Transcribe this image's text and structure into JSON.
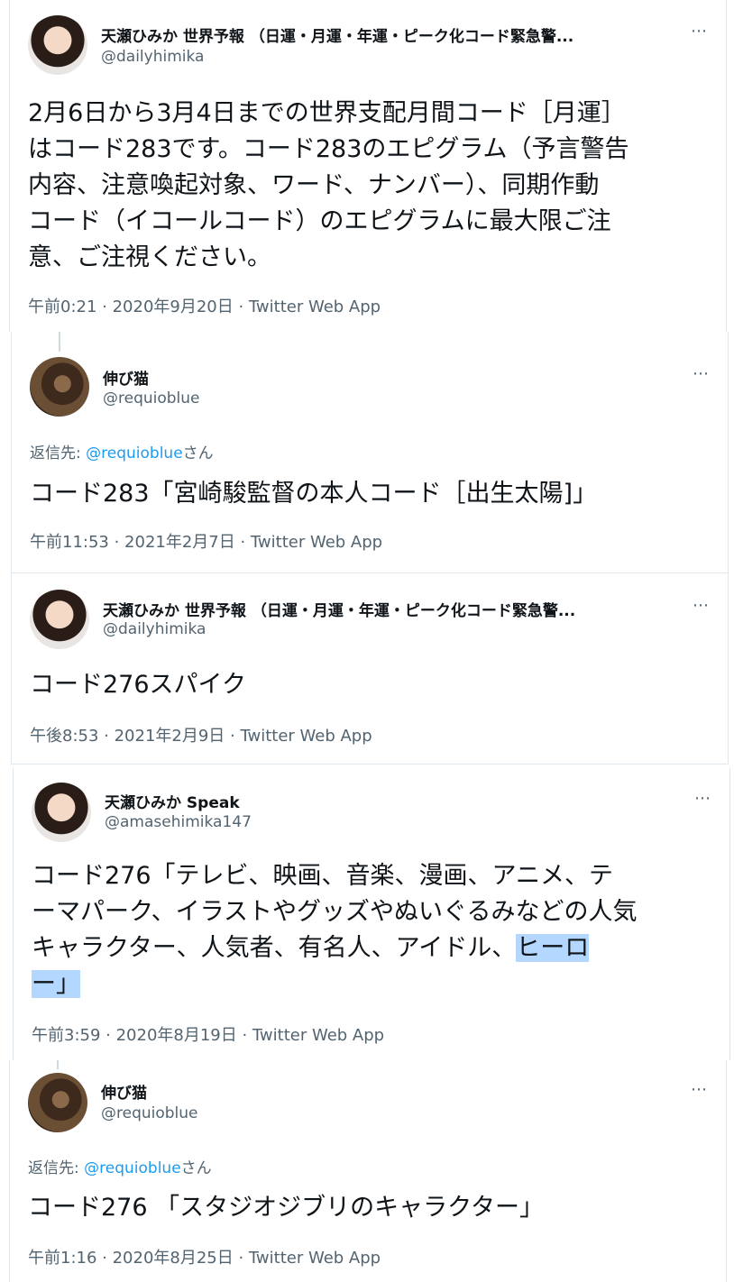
{
  "tweets": [
    {
      "name": "天瀬ひみか 世界予報 （日運・月運・年運・ピーク化コード緊急警...",
      "handle": "@dailyhimika",
      "lines": [
        "2月6日から3月4日までの世界支配月間コード［月運］",
        "はコード283です。コード283のエピグラム（予言警告",
        "内容、注意喚起対象、ワード、ナンバー）、同期作動",
        "コード（イコールコード）のエピグラムに最大限ご注",
        "意、ご注視ください。"
      ],
      "meta": "午前0:21 · 2020年9月20日 · Twitter Web App"
    },
    {
      "name": "伸び猫",
      "handle": "@requioblue",
      "reply_prefix": "返信先: ",
      "reply_link": "@requioblue",
      "reply_suffix": "さん",
      "lines": [
        "コード283「宮崎駿監督の本人コード［出生太陽]」"
      ],
      "meta": "午前11:53 · 2021年2月7日 · Twitter Web App"
    },
    {
      "name": "天瀬ひみか 世界予報 （日運・月運・年運・ピーク化コード緊急警...",
      "handle": "@dailyhimika",
      "lines": [
        "コード276スパイク"
      ],
      "meta": "午後8:53 · 2021年2月9日 · Twitter Web App"
    },
    {
      "name": "天瀬ひみか Speak",
      "handle": "@amasehimika147",
      "lines": [
        "コード276「テレビ、映画、音楽、漫画、アニメ、テ",
        "ーマパーク、イラストやグッズやぬいぐるみなどの人気",
        "キャラクター、人気者、有名人、アイドル、"
      ],
      "highlight_a": "ヒーロ",
      "highlight_b": "ー」",
      "meta": "午前3:59 · 2020年8月19日 · Twitter Web App"
    },
    {
      "name": "伸び猫",
      "handle": "@requioblue",
      "reply_prefix": "返信先: ",
      "reply_link": "@requioblue",
      "reply_suffix": "さん",
      "lines": [
        "コード276 「スタジオジブリのキャラクター」"
      ],
      "meta": "午前1:16 · 2020年8月25日 · Twitter Web App"
    }
  ],
  "more_icon": "⋯",
  "colors": {
    "link": "#1d9bf0",
    "highlight": "#b3d7ff",
    "muted": "#536471"
  }
}
